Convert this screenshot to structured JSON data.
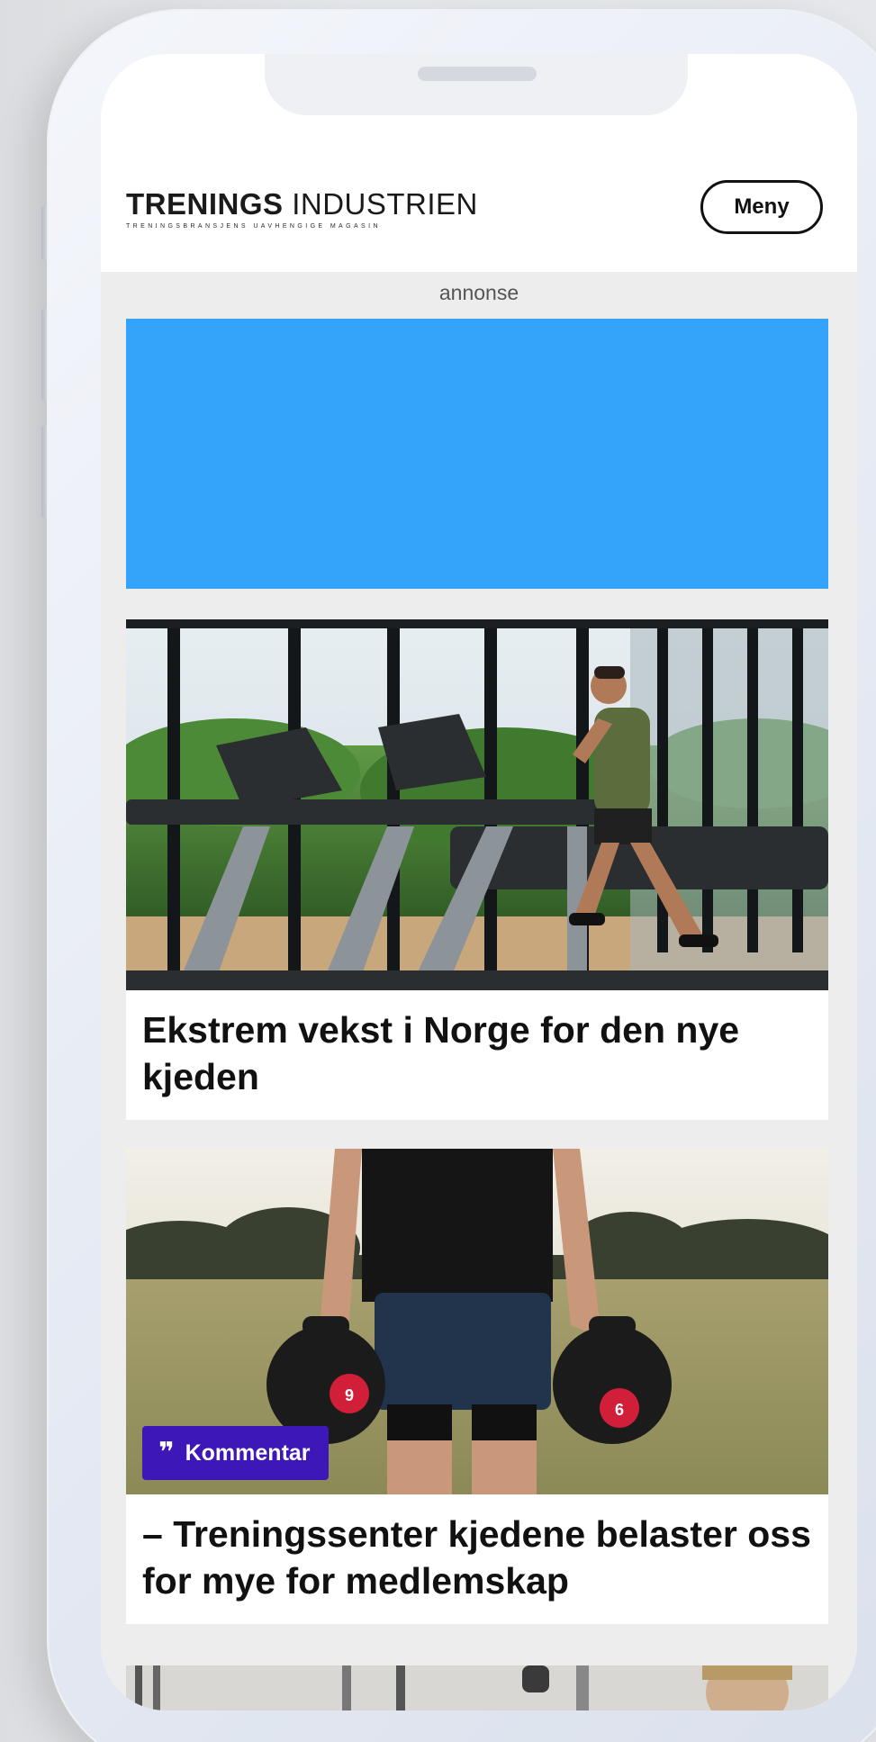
{
  "site": {
    "logo_bold": "TRENINGS",
    "logo_light": "INDUSTRIEN",
    "logo_tagline": "TRENINGSBRANSJENS UAVHENGIGE MAGASIN",
    "menu_label": "Meny"
  },
  "ad": {
    "label": "annonse",
    "color": "#33a4fa"
  },
  "articles": [
    {
      "title": "Ekstrem vekst i Norge for den nye kjeden",
      "image": "treadmill-gym-photo"
    },
    {
      "title": "– Treningssenter kjedene belaster oss for mye for medlemskap",
      "image": "kettlebell-field-photo",
      "badge": "Kommentar",
      "badge_icon": "quote-icon"
    },
    {
      "image": "gym-people-photo"
    }
  ],
  "colors": {
    "badge": "#3d17b8",
    "text": "#111111"
  }
}
